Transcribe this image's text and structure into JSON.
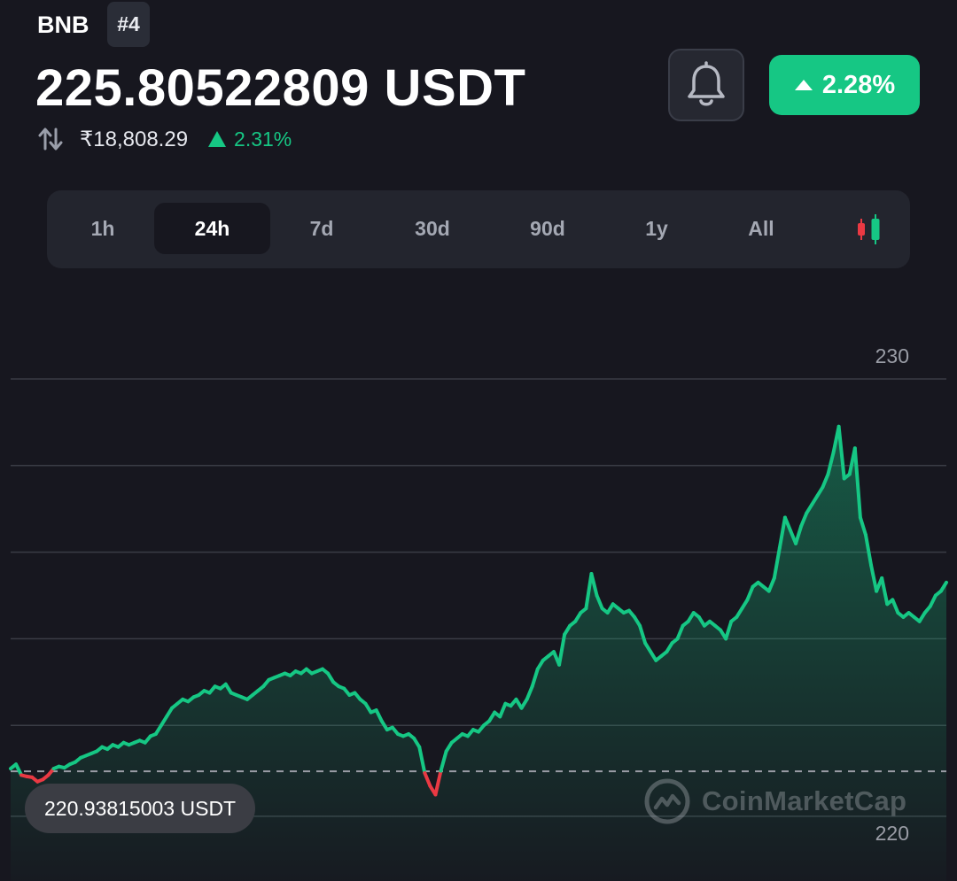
{
  "header": {
    "symbol": "BNB",
    "rank": "#4",
    "price": "225.80522809 USDT",
    "inr_price": "₹18,808.29",
    "inr_change": "2.31%",
    "change_badge": "2.28%"
  },
  "timeframes": [
    {
      "label": "1h",
      "active": false
    },
    {
      "label": "24h",
      "active": true
    },
    {
      "label": "7d",
      "active": false
    },
    {
      "label": "30d",
      "active": false
    },
    {
      "label": "90d",
      "active": false
    },
    {
      "label": "1y",
      "active": false
    },
    {
      "label": "All",
      "active": false
    }
  ],
  "icons": {
    "swap": "swap-arrows-icon",
    "up": "triangle-up-icon",
    "bell": "bell-icon",
    "candle": "candlestick-icon",
    "watermark_logo": "coinmarketcap-logo-icon"
  },
  "colors": {
    "up": "#16c784",
    "down": "#ea3943",
    "background": "#17171f"
  },
  "watermark": "CoinMarketCap",
  "chart_data": {
    "type": "area",
    "y_tick_labels": [
      "230",
      "220"
    ],
    "ylim": [
      219.5,
      230.5
    ],
    "grid": true,
    "reference_value": 220.938,
    "reference_label": "220.93815003 USDT",
    "values": [
      221.0,
      221.1,
      220.85,
      220.82,
      220.8,
      220.7,
      220.75,
      220.85,
      221.0,
      221.05,
      221.02,
      221.1,
      221.15,
      221.25,
      221.3,
      221.35,
      221.4,
      221.5,
      221.45,
      221.55,
      221.5,
      221.6,
      221.55,
      221.6,
      221.65,
      221.6,
      221.75,
      221.8,
      222.0,
      222.2,
      222.4,
      222.5,
      222.6,
      222.55,
      222.65,
      222.7,
      222.8,
      222.75,
      222.9,
      222.85,
      222.95,
      222.75,
      222.7,
      222.65,
      222.6,
      222.7,
      222.8,
      222.9,
      223.05,
      223.1,
      223.15,
      223.2,
      223.15,
      223.25,
      223.2,
      223.3,
      223.2,
      223.25,
      223.3,
      223.2,
      223.0,
      222.9,
      222.85,
      222.7,
      222.75,
      222.6,
      222.5,
      222.3,
      222.35,
      222.1,
      221.9,
      221.95,
      221.8,
      221.75,
      221.8,
      221.7,
      221.5,
      220.9,
      220.6,
      220.4,
      220.95,
      221.4,
      221.6,
      221.7,
      221.8,
      221.75,
      221.9,
      221.85,
      222.0,
      222.1,
      222.3,
      222.2,
      222.5,
      222.45,
      222.6,
      222.4,
      222.6,
      222.9,
      223.3,
      223.5,
      223.6,
      223.7,
      223.4,
      224.1,
      224.3,
      224.4,
      224.6,
      224.7,
      225.5,
      225.0,
      224.7,
      224.6,
      224.8,
      224.7,
      224.6,
      224.65,
      224.5,
      224.3,
      223.9,
      223.7,
      223.5,
      223.6,
      223.7,
      223.9,
      224.0,
      224.3,
      224.4,
      224.6,
      224.5,
      224.3,
      224.4,
      224.3,
      224.2,
      224.0,
      224.4,
      224.5,
      224.7,
      224.9,
      225.2,
      225.3,
      225.2,
      225.1,
      225.4,
      226.1,
      226.8,
      226.5,
      226.2,
      226.6,
      226.9,
      227.1,
      227.3,
      227.5,
      227.8,
      228.3,
      228.9,
      227.7,
      227.8,
      228.4,
      226.8,
      226.4,
      225.7,
      225.1,
      225.4,
      224.8,
      224.9,
      224.6,
      224.5,
      224.6,
      224.5,
      224.4,
      224.6,
      224.75,
      225.0,
      225.1,
      225.3
    ]
  }
}
